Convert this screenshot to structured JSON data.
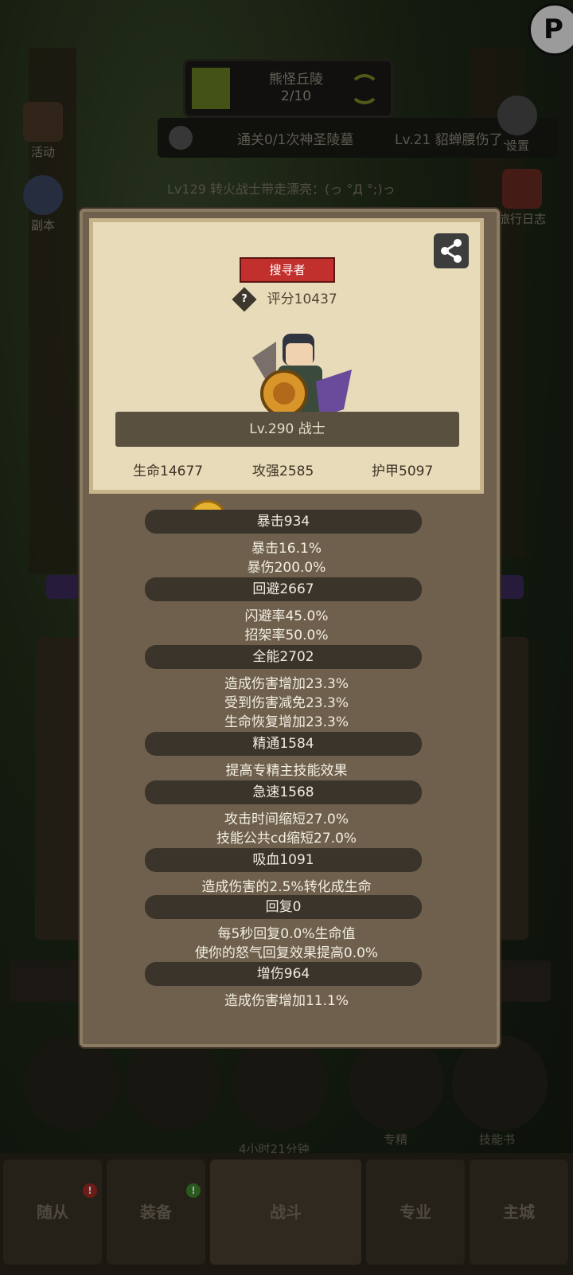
{
  "map": {
    "name": "熊怪丘陵",
    "progress": "2/10"
  },
  "quest": {
    "text": "通关0/1次神圣陵墓",
    "chat_preview": "Lv.21 貂蝉腰伤了..."
  },
  "side_left": [
    {
      "label": "活动"
    },
    {
      "label": "副本"
    }
  ],
  "side_right": [
    {
      "label": "设置"
    },
    {
      "label": "旅行日志"
    }
  ],
  "chat_line": "Lv129 转火战士带走漂亮：(っ °Д °;)っ",
  "modal": {
    "role_tag": "搜寻者",
    "score": "评分10437",
    "level_class": "Lv.290 战士",
    "hp": "生命14677",
    "attack": "攻强2585",
    "armor": "护甲5097",
    "stats": [
      {
        "title": "暴击934",
        "lines": [
          "暴击16.1%",
          "暴伤200.0%"
        ]
      },
      {
        "title": "回避2667",
        "lines": [
          "闪避率45.0%",
          "招架率50.0%"
        ]
      },
      {
        "title": "全能2702",
        "lines": [
          "造成伤害增加23.3%",
          "受到伤害减免23.3%",
          "生命恢复增加23.3%"
        ]
      },
      {
        "title": "精通1584",
        "lines": [
          "提高专精主技能效果"
        ]
      },
      {
        "title": "急速1568",
        "lines": [
          "攻击时间缩短27.0%",
          "技能公共cd缩短27.0%"
        ]
      },
      {
        "title": "吸血1091",
        "lines": [
          "造成伤害的2.5%转化成生命"
        ]
      },
      {
        "title": "回复0",
        "lines": [
          "每5秒回复0.0%生命值",
          "使你的怒气回复效果提高0.0%"
        ]
      },
      {
        "title": "增伤964",
        "lines": [
          "造成伤害增加11.1%"
        ]
      }
    ]
  },
  "bottom": {
    "chest_timer": "4小时21分钟",
    "specialty": "专精",
    "skillbook": "技能书"
  },
  "nav": [
    {
      "label": "随从"
    },
    {
      "label": "装备"
    },
    {
      "label": "战斗"
    },
    {
      "label": "专业"
    },
    {
      "label": "主城"
    }
  ],
  "colors": {
    "role_tag": "#c2302d",
    "card_bg": "#e8dbb9",
    "panel_bg": "#6e604d"
  }
}
